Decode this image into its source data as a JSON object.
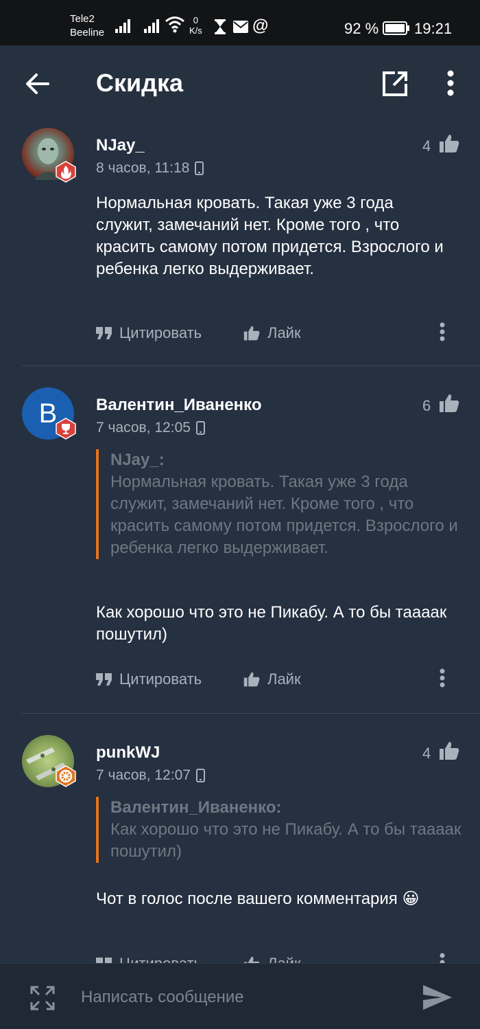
{
  "status_bar": {
    "carrier_1": "Tele2",
    "carrier_2": "Beeline",
    "net_speed_value": "0",
    "net_speed_unit": "K/s",
    "battery": "92 %",
    "time": "19:21"
  },
  "appbar": {
    "title": "Скидка"
  },
  "comments": [
    {
      "author": "NJay_",
      "meta": "8 часов, 11:18",
      "likes": "4",
      "text": "Нормальная кровать. Такая уже 3 года служит, замечаний нет. Кроме того , что красить самому потом придется. Взрослого и ребенка легко выдерживает.",
      "quote_label": "Цитировать",
      "like_label": "Лайк"
    },
    {
      "author": "Валентин_Иваненко",
      "avatar_letter": "B",
      "meta": "7 часов, 12:05",
      "likes": "6",
      "quote": {
        "author": "NJay_:",
        "text": "Нормальная кровать. Такая уже 3 года служит, замечаний нет. Кроме того , что красить самому потом придется. Взрослого и ребенка легко выдерживает."
      },
      "text": "Как хорошо что это не Пикабу. А то бы тааaак пошутил)",
      "quote_label": "Цитировать",
      "like_label": "Лайк"
    },
    {
      "author": "punkWJ",
      "meta": "7 часов, 12:07",
      "likes": "4",
      "quote": {
        "author": "Валентин_Иваненко:",
        "text": "Как хорошо что это не Пикабу. А то бы тааaак пошутил)"
      },
      "text": "Чот в голос после вашего комментария",
      "emoji": "😀",
      "quote_label": "Цитировать",
      "like_label": "Лайк"
    }
  ],
  "input": {
    "placeholder": "Написать сообщение"
  },
  "colors": {
    "background": "#253040",
    "accent_quote": "#e7741c",
    "muted_text": "#a9b1bb",
    "badge_red": "#d9403a",
    "badge_orange": "#e0761f"
  },
  "icons": {
    "back": "arrow-left-icon",
    "open": "open-external-icon",
    "more": "more-vertical-icon",
    "like": "thumbs-up-icon",
    "quote": "quote-icon",
    "device": "phone-icon",
    "expand": "expand-icon",
    "send": "send-icon"
  }
}
